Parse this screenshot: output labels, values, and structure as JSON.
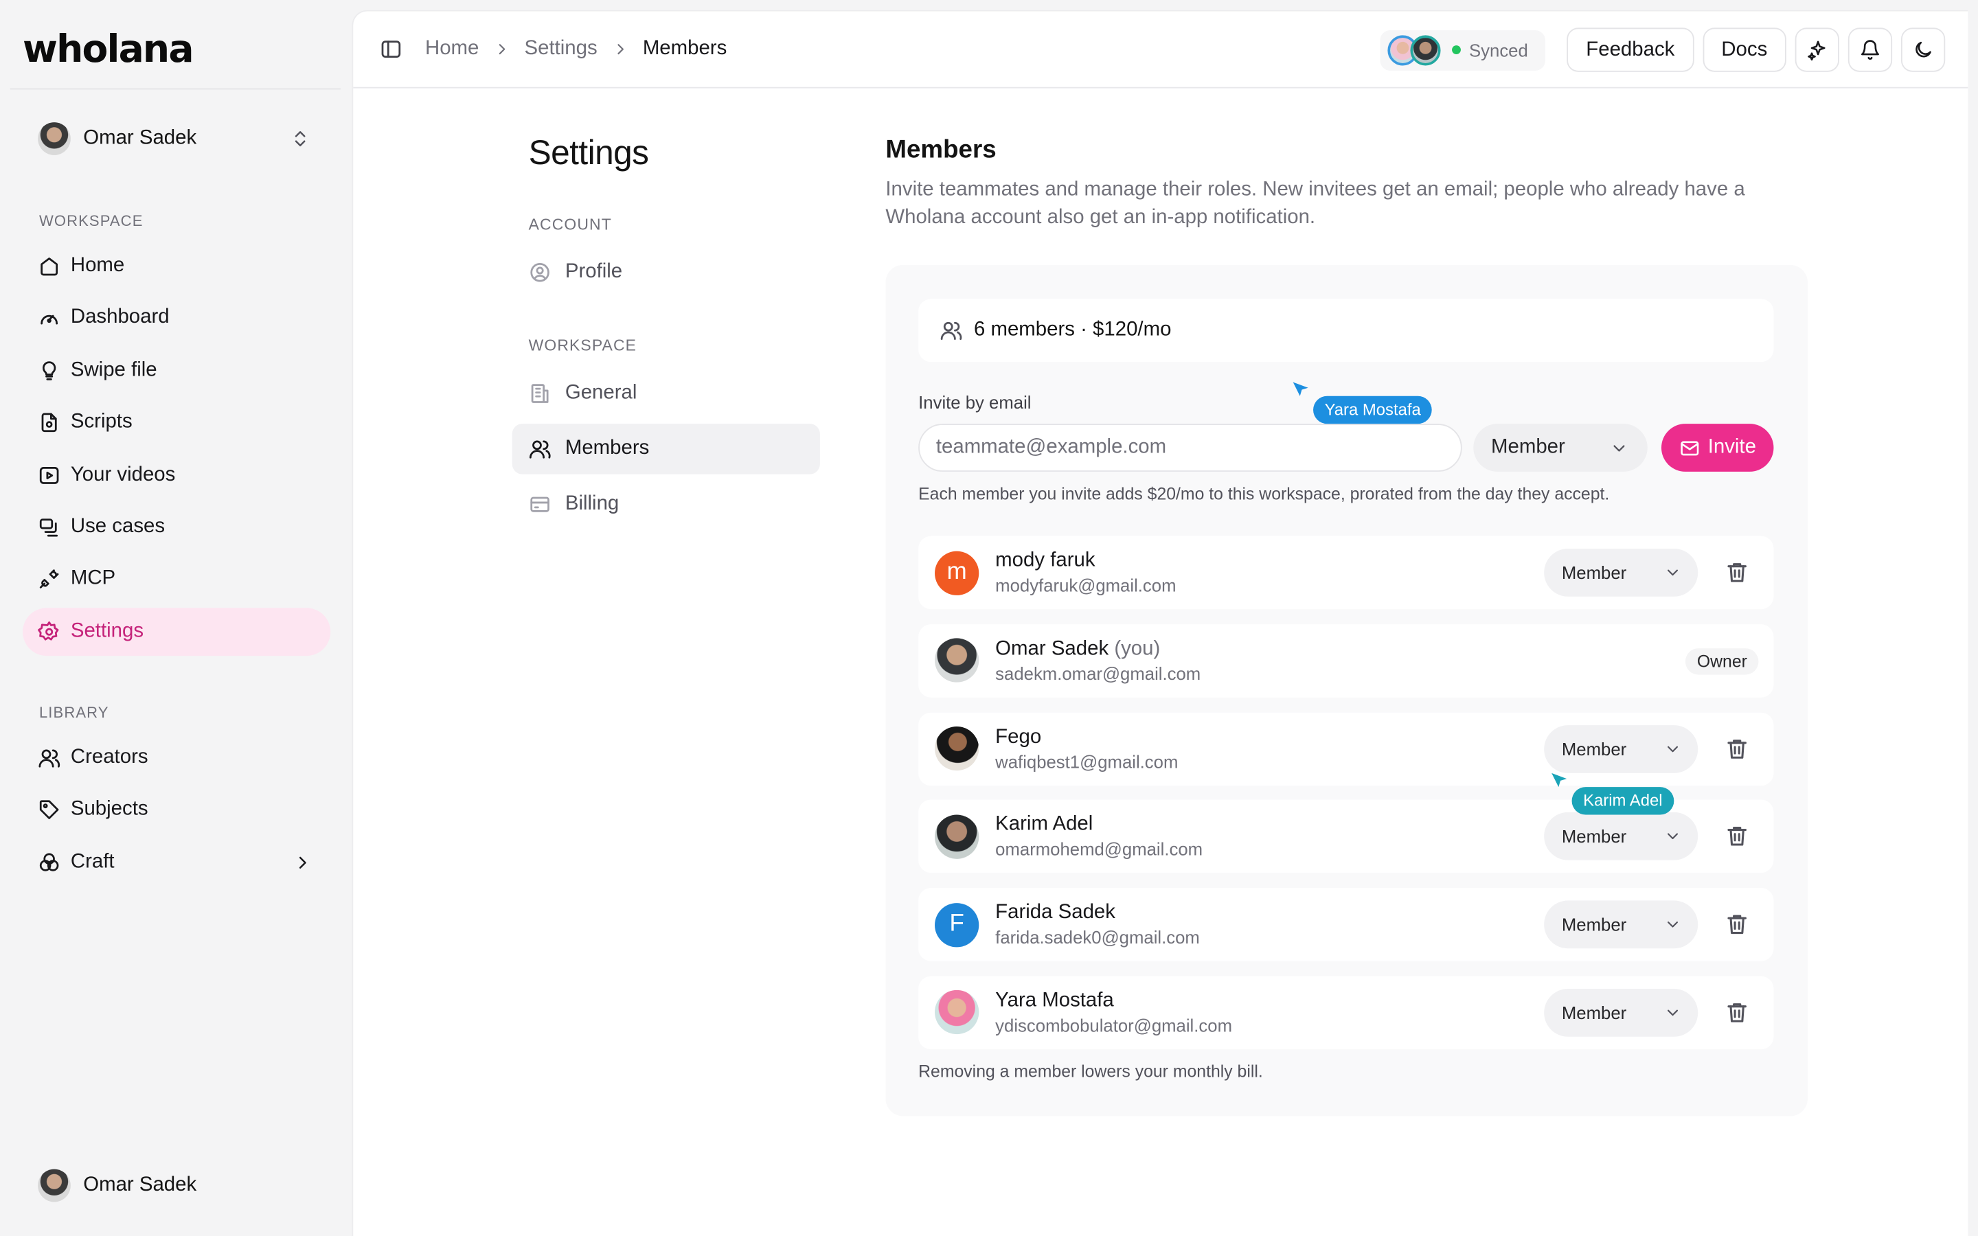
{
  "brand": {
    "logo": "wholana"
  },
  "sidebar": {
    "user_name": "Omar Sadek",
    "workspace_section": "WORKSPACE",
    "workspace_items": [
      {
        "label": "Home",
        "icon": "home-icon"
      },
      {
        "label": "Dashboard",
        "icon": "gauge-icon"
      },
      {
        "label": "Swipe file",
        "icon": "lightbulb-icon"
      },
      {
        "label": "Scripts",
        "icon": "script-icon"
      },
      {
        "label": "Your videos",
        "icon": "video-icon"
      },
      {
        "label": "Use cases",
        "icon": "use-cases-icon"
      },
      {
        "label": "MCP",
        "icon": "plug-icon"
      },
      {
        "label": "Settings",
        "icon": "gear-icon",
        "active": true
      }
    ],
    "library_section": "LIBRARY",
    "library_items": [
      {
        "label": "Creators",
        "icon": "users-icon"
      },
      {
        "label": "Subjects",
        "icon": "tag-icon"
      },
      {
        "label": "Craft",
        "icon": "craft-icon"
      }
    ],
    "bottom_user_name": "Omar Sadek"
  },
  "topbar": {
    "breadcrumbs": [
      "Home",
      "Settings",
      "Members"
    ],
    "sync_status": "Synced",
    "feedback_label": "Feedback",
    "docs_label": "Docs"
  },
  "settings_nav": {
    "title": "Settings",
    "account_section": "ACCOUNT",
    "account_items": [
      {
        "label": "Profile"
      }
    ],
    "workspace_section": "WORKSPACE",
    "workspace_items": [
      {
        "label": "General"
      },
      {
        "label": "Members",
        "active": true
      },
      {
        "label": "Billing"
      }
    ]
  },
  "members": {
    "title": "Members",
    "description": "Invite teammates and manage their roles. New invitees get an email; people who already have a Wholana account also get an in-app notification.",
    "summary": "6 members · $120/mo",
    "invite_label": "Invite by email",
    "invite_placeholder": "teammate@example.com",
    "invite_role": "Member",
    "invite_button": "Invite",
    "invite_note": "Each member you invite adds $20/mo to this workspace, prorated from the day they accept.",
    "list": [
      {
        "name": "mody faruk",
        "you": "",
        "email": "modyfaruk@gmail.com",
        "role": "Member",
        "avatar": "m"
      },
      {
        "name": "Omar Sadek",
        "you": "(you)",
        "email": "sadekm.omar@gmail.com",
        "role": "Owner",
        "avatar": ""
      },
      {
        "name": "Fego",
        "you": "",
        "email": "wafiqbest1@gmail.com",
        "role": "Member",
        "avatar": ""
      },
      {
        "name": "Karim Adel",
        "you": "",
        "email": "omarmohemd@gmail.com",
        "role": "Member",
        "avatar": ""
      },
      {
        "name": "Farida Sadek",
        "you": "",
        "email": "farida.sadek0@gmail.com",
        "role": "Member",
        "avatar": "F"
      },
      {
        "name": "Yara Mostafa",
        "you": "",
        "email": "ydiscombobulator@gmail.com",
        "role": "Member",
        "avatar": ""
      }
    ],
    "footer_note": "Removing a member lowers your monthly bill."
  },
  "cursors": [
    {
      "name": "Yara Mostafa",
      "color": "#1d8fe0"
    },
    {
      "name": "Karim Adel",
      "color": "#1ba4b8"
    }
  ],
  "colors": {
    "accent": "#ec2d8d",
    "active_nav_bg": "#fde5f1",
    "synced": "#22c55e"
  }
}
